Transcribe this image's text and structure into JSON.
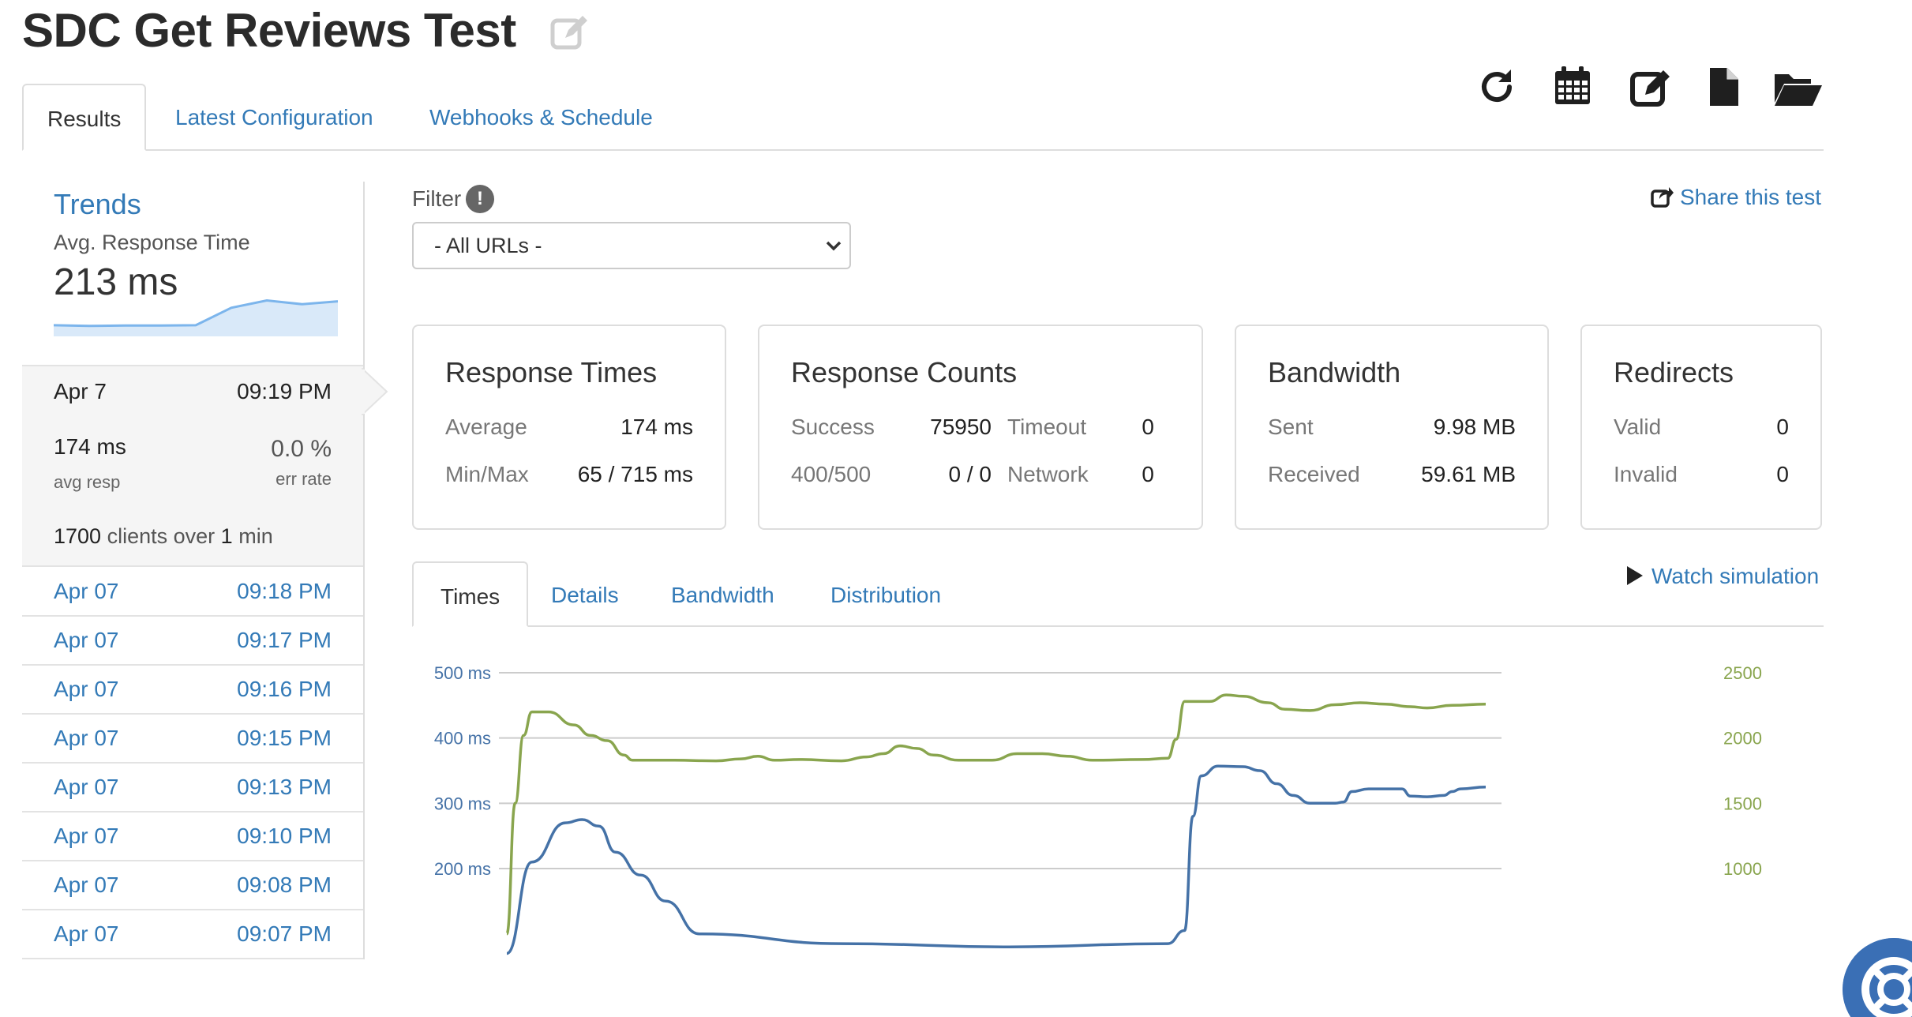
{
  "page": {
    "title": "SDC Get Reviews Test"
  },
  "toolbar": {
    "icons": [
      "refresh-icon",
      "calendar-icon",
      "edit-icon",
      "copy-file-icon",
      "folder-open-icon"
    ]
  },
  "tabs": [
    {
      "label": "Results",
      "active": true
    },
    {
      "label": "Latest Configuration",
      "active": false
    },
    {
      "label": "Webhooks & Schedule",
      "active": false
    }
  ],
  "trends": {
    "title": "Trends",
    "metric_label": "Avg. Response Time",
    "metric_value": "213 ms"
  },
  "current_run": {
    "date": "Apr 7",
    "time": "09:19 PM",
    "avg_resp": "174 ms",
    "avg_resp_label": "avg resp",
    "err_rate": "0.0 %",
    "err_rate_label": "err rate",
    "clients": "1700",
    "clients_middle": "clients over",
    "duration": "1",
    "duration_unit": "min"
  },
  "runs": [
    {
      "date": "Apr 07",
      "time": "09:18 PM"
    },
    {
      "date": "Apr 07",
      "time": "09:17 PM"
    },
    {
      "date": "Apr 07",
      "time": "09:16 PM"
    },
    {
      "date": "Apr 07",
      "time": "09:15 PM"
    },
    {
      "date": "Apr 07",
      "time": "09:13 PM"
    },
    {
      "date": "Apr 07",
      "time": "09:10 PM"
    },
    {
      "date": "Apr 07",
      "time": "09:08 PM"
    },
    {
      "date": "Apr 07",
      "time": "09:07 PM"
    }
  ],
  "filter": {
    "label": "Filter",
    "info_glyph": "!",
    "selected": "- All URLs -"
  },
  "share": {
    "label": "Share this test"
  },
  "cards": {
    "response_times": {
      "title": "Response Times",
      "average_label": "Average",
      "average_value": "174 ms",
      "minmax_label": "Min/Max",
      "minmax_value": "65 / 715 ms"
    },
    "response_counts": {
      "title": "Response Counts",
      "success_label": "Success",
      "success_value": "75950",
      "timeout_label": "Timeout",
      "timeout_value": "0",
      "err_label": "400/500",
      "err_value": "0 / 0",
      "network_label": "Network",
      "network_value": "0"
    },
    "bandwidth": {
      "title": "Bandwidth",
      "sent_label": "Sent",
      "sent_value": "9.98 MB",
      "received_label": "Received",
      "received_value": "59.61 MB"
    },
    "redirects": {
      "title": "Redirects",
      "valid_label": "Valid",
      "valid_value": "0",
      "invalid_label": "Invalid",
      "invalid_value": "0"
    }
  },
  "chart_tabs": [
    {
      "label": "Times",
      "active": true
    },
    {
      "label": "Details",
      "active": false
    },
    {
      "label": "Bandwidth",
      "active": false
    },
    {
      "label": "Distribution",
      "active": false
    }
  ],
  "watch": {
    "label": "Watch simulation"
  },
  "colors": {
    "link": "#337ab7",
    "response_line": "#4572a7",
    "clients_line": "#89a54e",
    "sparkline": "#7cb5ec"
  },
  "sparkline_values": [
    150,
    148,
    149,
    149,
    150,
    210,
    235,
    222,
    232
  ],
  "chart_data": {
    "type": "line",
    "left_axis": {
      "ticks": [
        "500 ms",
        "400 ms",
        "300 ms",
        "200 ms"
      ],
      "range": [
        100,
        500
      ]
    },
    "right_axis": {
      "ticks": [
        "2500",
        "2000",
        "1500",
        "1000"
      ],
      "range": [
        500,
        2500
      ]
    },
    "grid": true,
    "series": [
      {
        "axis": "left",
        "points": [
          [
            0,
            70
          ],
          [
            3,
            210
          ],
          [
            7,
            270
          ],
          [
            9,
            275
          ],
          [
            11,
            265
          ],
          [
            13,
            225
          ],
          [
            16,
            190
          ],
          [
            19,
            150
          ],
          [
            23,
            100
          ],
          [
            40,
            85
          ],
          [
            60,
            80
          ],
          [
            79,
            85
          ],
          [
            81,
            105
          ],
          [
            82,
            280
          ],
          [
            83,
            342
          ],
          [
            85,
            357
          ],
          [
            88,
            356
          ],
          [
            90,
            350
          ],
          [
            92,
            330
          ],
          [
            94,
            312
          ],
          [
            96,
            300
          ],
          [
            99,
            300
          ],
          [
            100,
            302
          ],
          [
            101,
            318
          ],
          [
            103,
            322
          ],
          [
            107,
            322
          ],
          [
            108,
            311
          ],
          [
            110,
            310
          ],
          [
            112,
            312
          ],
          [
            113,
            318
          ],
          [
            114,
            322
          ],
          [
            117,
            325
          ]
        ]
      },
      {
        "axis": "right",
        "points": [
          [
            0,
            500
          ],
          [
            1,
            1500
          ],
          [
            2,
            2020
          ],
          [
            3,
            2200
          ],
          [
            5,
            2200
          ],
          [
            8,
            2100
          ],
          [
            10,
            2020
          ],
          [
            12,
            1980
          ],
          [
            14,
            1870
          ],
          [
            15,
            1830
          ],
          [
            20,
            1830
          ],
          [
            25,
            1825
          ],
          [
            28,
            1840
          ],
          [
            30,
            1860
          ],
          [
            32,
            1830
          ],
          [
            35,
            1835
          ],
          [
            40,
            1825
          ],
          [
            43,
            1855
          ],
          [
            45,
            1880
          ],
          [
            47,
            1940
          ],
          [
            49,
            1920
          ],
          [
            51,
            1870
          ],
          [
            54,
            1830
          ],
          [
            58,
            1830
          ],
          [
            61,
            1880
          ],
          [
            64,
            1880
          ],
          [
            67,
            1860
          ],
          [
            70,
            1830
          ],
          [
            76,
            1835
          ],
          [
            79,
            1845
          ],
          [
            80,
            1990
          ],
          [
            81,
            2280
          ],
          [
            84,
            2280
          ],
          [
            86,
            2330
          ],
          [
            88,
            2320
          ],
          [
            91,
            2270
          ],
          [
            93,
            2220
          ],
          [
            96,
            2210
          ],
          [
            99,
            2255
          ],
          [
            102,
            2270
          ],
          [
            105,
            2260
          ],
          [
            108,
            2240
          ],
          [
            110,
            2230
          ],
          [
            113,
            2250
          ],
          [
            117,
            2260
          ]
        ]
      }
    ]
  }
}
